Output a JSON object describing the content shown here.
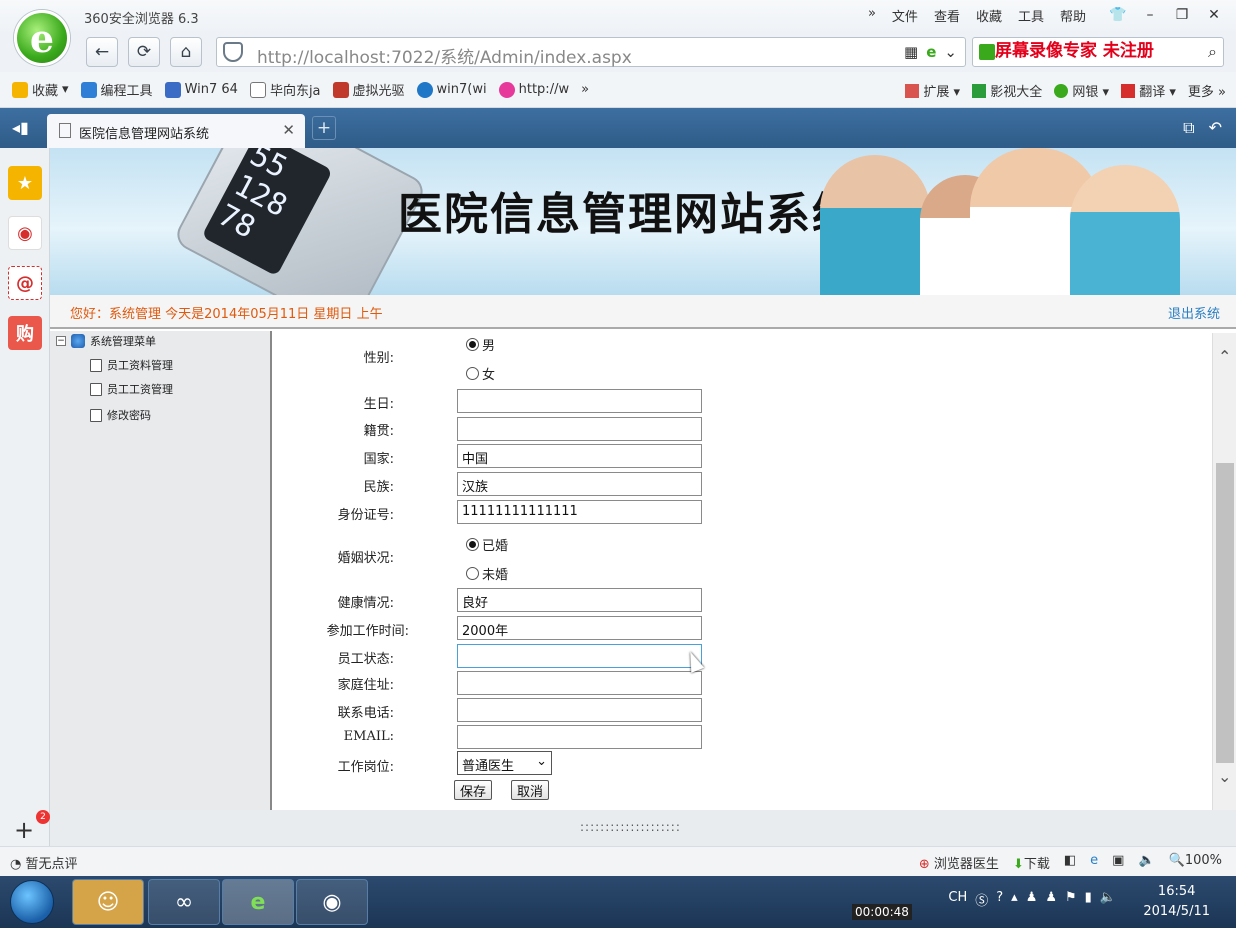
{
  "browser": {
    "app_title": "360安全浏览器 6.3",
    "menu": [
      "文件",
      "查看",
      "收藏",
      "工具",
      "帮助"
    ],
    "url": "http://localhost:7022/系统/Admin/index.aspx",
    "watermark": "屏幕录像专家 未注册",
    "bookmarks": [
      "收藏",
      "编程工具",
      "Win7 64",
      "毕向东ja",
      "虚拟光驱",
      "win7(wi",
      "http://w"
    ],
    "bookmarks_right": [
      "扩展",
      "影视大全",
      "网银",
      "翻译",
      "更多"
    ],
    "tab_title": "医院信息管理网站系统"
  },
  "banner": {
    "title": "医院信息管理网站系统"
  },
  "infobar": {
    "greeting": "您好：系统管理   今天是2014年05月11日   星期日   上午",
    "logout": "退出系统"
  },
  "menu_tree": {
    "root": "系统管理菜单",
    "items": [
      "员工资料管理",
      "员工工资管理",
      "修改密码"
    ]
  },
  "form": {
    "gender": {
      "label": "性别:",
      "options": [
        "男",
        "女"
      ],
      "selected": "男"
    },
    "birthday": {
      "label": "生日:",
      "value": ""
    },
    "native_place": {
      "label": "籍贯:",
      "value": ""
    },
    "country": {
      "label": "国家:",
      "value": "中国"
    },
    "ethnicity": {
      "label": "民族:",
      "value": "汉族"
    },
    "id_number": {
      "label": "身份证号:",
      "value": "11111111111111"
    },
    "marital": {
      "label": "婚姻状况:",
      "options": [
        "已婚",
        "未婚"
      ],
      "selected": "已婚"
    },
    "health": {
      "label": "健康情况:",
      "value": "良好"
    },
    "work_start": {
      "label": "参加工作时间:",
      "value": "2000年"
    },
    "status": {
      "label": "员工状态:",
      "value": ""
    },
    "address": {
      "label": "家庭住址:",
      "value": ""
    },
    "phone": {
      "label": "联系电话:",
      "value": ""
    },
    "email": {
      "label": "EMAIL:",
      "value": ""
    },
    "position": {
      "label": "工作岗位:",
      "value": "普通医生"
    },
    "save_label": "保存",
    "cancel_label": "取消"
  },
  "statusbar": {
    "left": "暂无点评",
    "doctor": "浏览器医生",
    "download": "下载",
    "zoom": "100%"
  },
  "taskbar": {
    "lang": "CH",
    "time": "16:54",
    "date": "2014/5/11",
    "recorder_time": "00:00:48"
  }
}
